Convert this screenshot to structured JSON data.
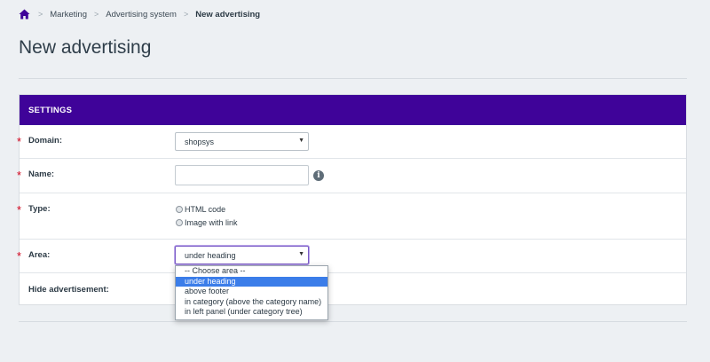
{
  "breadcrumb": {
    "items": [
      "Marketing",
      "Advertising system"
    ],
    "current": "New advertising",
    "separator": ">"
  },
  "page_title": "New advertising",
  "settings": {
    "header": "SETTINGS",
    "required_marker": "*",
    "domain": {
      "label": "Domain:",
      "value": "shopsys"
    },
    "name": {
      "label": "Name:",
      "value": ""
    },
    "type": {
      "label": "Type:",
      "options": [
        "HTML code",
        "Image with link"
      ]
    },
    "area": {
      "label": "Area:",
      "value": "under heading",
      "options": [
        "-- Choose area --",
        "under heading",
        "above footer",
        "in category (above the category name)",
        "in left panel (under category tree)"
      ],
      "highlighted_index": 1
    },
    "hide": {
      "label": "Hide advertisement:"
    }
  },
  "icons": {
    "home": "home-icon",
    "info": "info-icon",
    "caret": "caret-down-icon"
  },
  "colors": {
    "header_bg": "#3f0399",
    "accent": "#7a5bc7",
    "highlight": "#3b7de9",
    "required": "#d0021b",
    "home_icon": "#3f0399"
  }
}
